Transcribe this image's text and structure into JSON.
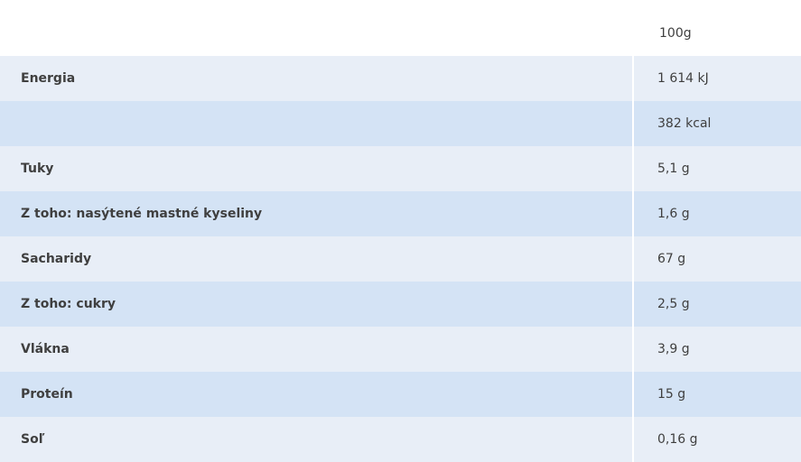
{
  "table": {
    "header": {
      "label": "",
      "value": "100g"
    },
    "rows": [
      {
        "label": "Energia",
        "value": "1 614 kJ"
      },
      {
        "label": "",
        "value": "382 kcal"
      },
      {
        "label": "Tuky",
        "value": "5,1 g"
      },
      {
        "label": "Z toho: nasýtené mastné kyseliny",
        "value": "1,6 g"
      },
      {
        "label": "Sacharidy",
        "value": "67 g"
      },
      {
        "label": "Z toho: cukry",
        "value": "2,5 g"
      },
      {
        "label": "Vlákna",
        "value": "3,9 g"
      },
      {
        "label": "Proteín",
        "value": "15 g"
      },
      {
        "label": "Soľ",
        "value": "0,16 g"
      }
    ]
  },
  "colors": {
    "row_light": "#e8eef7",
    "row_dark": "#d4e3f5",
    "text": "#3f3f3f",
    "header_bg": "#ffffff"
  }
}
